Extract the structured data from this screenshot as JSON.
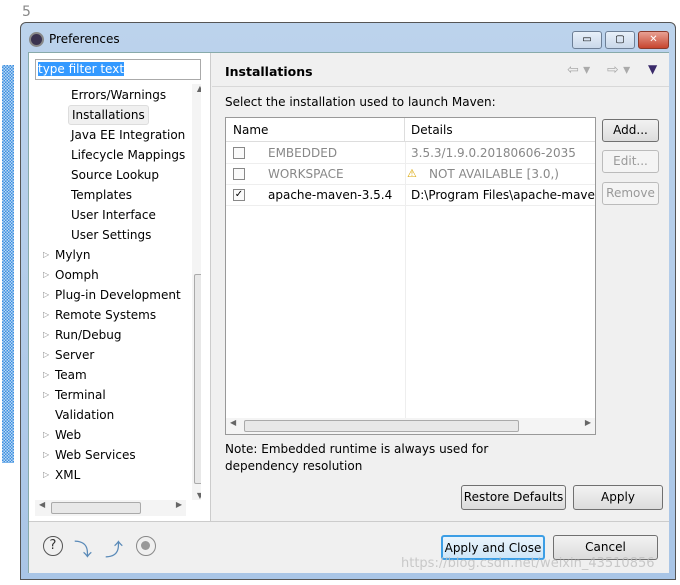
{
  "window": {
    "title": "Preferences",
    "minimize": "▭",
    "maximize": "▢",
    "close": "✕"
  },
  "gutter": [
    "5"
  ],
  "filter": {
    "value": "type filter text"
  },
  "tree": [
    {
      "label": "Errors/Warnings",
      "level": 2
    },
    {
      "label": "Installations",
      "level": 2,
      "selected": true
    },
    {
      "label": "Java EE Integration",
      "level": 2
    },
    {
      "label": "Lifecycle Mappings",
      "level": 2
    },
    {
      "label": "Source Lookup",
      "level": 2
    },
    {
      "label": "Templates",
      "level": 2
    },
    {
      "label": "User Interface",
      "level": 2
    },
    {
      "label": "User Settings",
      "level": 2
    },
    {
      "label": "Mylyn",
      "level": 1,
      "expandable": true
    },
    {
      "label": "Oomph",
      "level": 1,
      "expandable": true
    },
    {
      "label": "Plug-in Development",
      "level": 1,
      "expandable": true
    },
    {
      "label": "Remote Systems",
      "level": 1,
      "expandable": true
    },
    {
      "label": "Run/Debug",
      "level": 1,
      "expandable": true
    },
    {
      "label": "Server",
      "level": 1,
      "expandable": true
    },
    {
      "label": "Team",
      "level": 1,
      "expandable": true
    },
    {
      "label": "Terminal",
      "level": 1,
      "expandable": true
    },
    {
      "label": "Validation",
      "level": 1
    },
    {
      "label": "Web",
      "level": 1,
      "expandable": true
    },
    {
      "label": "Web Services",
      "level": 1,
      "expandable": true
    },
    {
      "label": "XML",
      "level": 1,
      "expandable": true
    }
  ],
  "page": {
    "title": "Installations",
    "instruction": "Select the installation used to launch Maven:",
    "columns": [
      "Name",
      "Details"
    ],
    "rows": [
      {
        "checked": false,
        "name": "EMBEDDED",
        "details": "3.5.3/1.9.0.20180606-2035",
        "disabled": true
      },
      {
        "checked": false,
        "name": "WORKSPACE",
        "details": "NOT AVAILABLE [3.0,)",
        "disabled": true,
        "warning": true
      },
      {
        "checked": true,
        "name": "apache-maven-3.5.4",
        "details": "D:\\Program Files\\apache-maven"
      }
    ],
    "buttons": {
      "add": "Add...",
      "edit": "Edit...",
      "remove": "Remove"
    },
    "note": "Note: Embedded runtime is always used for dependency resolution",
    "restore": "Restore Defaults",
    "apply": "Apply"
  },
  "footer": {
    "apply_close": "Apply and Close",
    "cancel": "Cancel"
  },
  "watermark": "https://blog.csdn.net/weixin_43510856",
  "colors": {
    "selection": "#3399ff",
    "accent_button": "#3c9ee5"
  }
}
